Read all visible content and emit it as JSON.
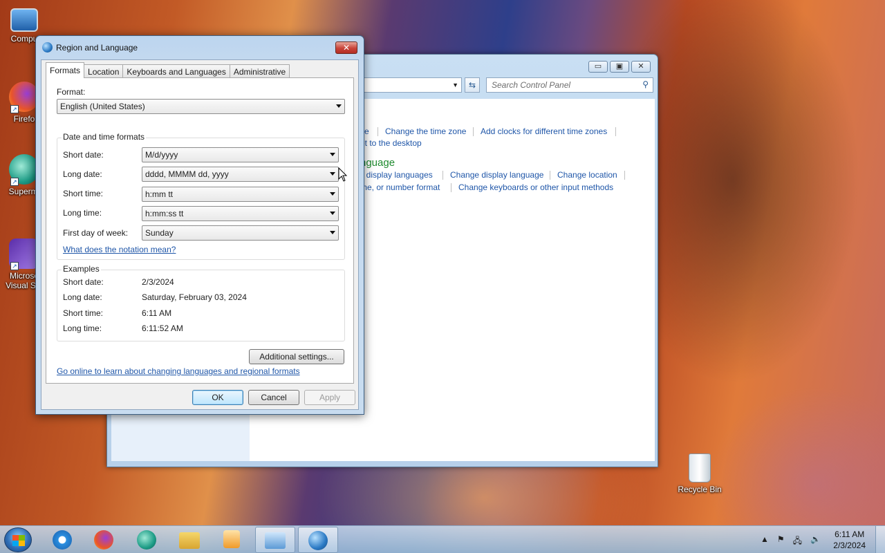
{
  "desktop": {
    "icons": [
      {
        "label": "Compu",
        "icon": "computer-icon"
      },
      {
        "label": "Firefo",
        "icon": "firefox-icon"
      },
      {
        "label": "Supermi",
        "icon": "supermium-icon"
      },
      {
        "label": "Microso",
        "label2": "Visual Stu",
        "icon": "visual-studio-icon"
      },
      {
        "label": "Recycle Bin",
        "icon": "recycle-bin-icon"
      }
    ]
  },
  "control_panel": {
    "search_placeholder": "Search Control Panel",
    "links": {
      "ce": "ce",
      "change_time_zone": "Change the time zone",
      "add_clocks": "Add clocks for different time zones",
      "et_desktop": "et to the desktop",
      "install_languages": "ll display languages",
      "change_display_language": "Change display language",
      "change_location": "Change location",
      "number_format": "me, or number format",
      "change_keyboards": "Change keyboards or other input methods"
    },
    "heading": "nguage"
  },
  "dialog": {
    "title": "Region and Language",
    "close": "✕",
    "tabs": [
      "Formats",
      "Location",
      "Keyboards and Languages",
      "Administrative"
    ],
    "format_label": "Format:",
    "format_value": "English (United States)",
    "date_time_group": "Date and time formats",
    "fields": [
      {
        "label": "Short date:",
        "value": "M/d/yyyy"
      },
      {
        "label": "Long date:",
        "value": "dddd, MMMM dd, yyyy"
      },
      {
        "label": "Short time:",
        "value": "h:mm tt"
      },
      {
        "label": "Long time:",
        "value": "h:mm:ss tt"
      },
      {
        "label": "First day of week:",
        "value": "Sunday"
      }
    ],
    "notation_link": "What does the notation mean?",
    "examples_group": "Examples",
    "examples": [
      {
        "label": "Short date:",
        "value": "2/3/2024"
      },
      {
        "label": "Long date:",
        "value": "Saturday, February 03, 2024"
      },
      {
        "label": "Short time:",
        "value": "6:11 AM"
      },
      {
        "label": "Long time:",
        "value": "6:11:52 AM"
      }
    ],
    "additional_settings": "Additional settings...",
    "online_link": "Go online to learn about changing languages and regional formats",
    "ok": "OK",
    "cancel": "Cancel",
    "apply": "Apply"
  },
  "taskbar": {
    "items": [
      "internet-explorer-icon",
      "firefox-icon",
      "supermium-icon",
      "file-explorer-icon",
      "media-player-icon",
      "control-panel-icon",
      "region-language-icon"
    ],
    "time": "6:11 AM",
    "date": "2/3/2024"
  }
}
